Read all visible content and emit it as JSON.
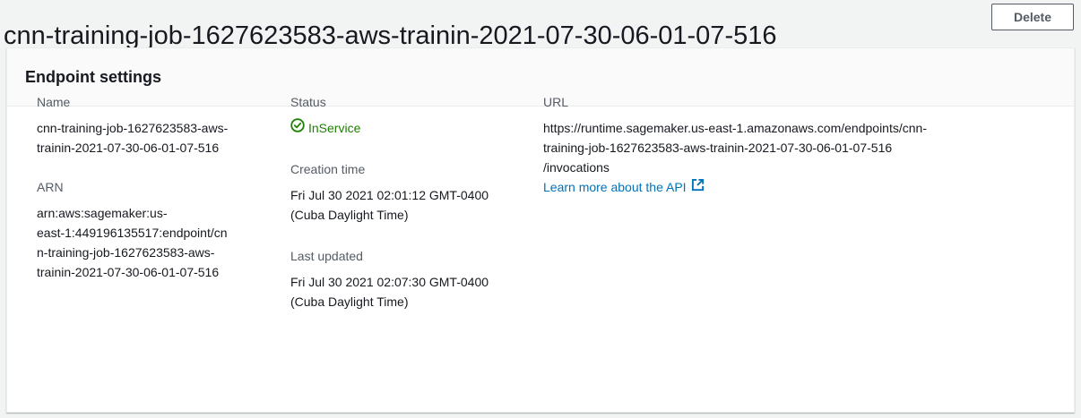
{
  "header": {
    "title": "cnn-training-job-1627623583-aws-trainin-2021-07-30-06-01-07-516",
    "delete_label": "Delete"
  },
  "card": {
    "title": "Endpoint settings"
  },
  "details": {
    "name_label": "Name",
    "name_line1": "cnn-training-job-1627623583-aws-",
    "name_line2": "trainin-2021-07-30-06-01-07-516",
    "arn_label": "ARN",
    "arn_line1": "arn:aws:sagemaker:us-",
    "arn_line2": "east-1:449196135517:endpoint/cn",
    "arn_line3": "n-training-job-1627623583-aws-",
    "arn_line4": "trainin-2021-07-30-06-01-07-516",
    "status_label": "Status",
    "status_value": "InService",
    "creation_label": "Creation time",
    "creation_line1": "Fri Jul 30 2021 02:01:12 GMT-0400",
    "creation_line2": "(Cuba Daylight Time)",
    "updated_label": "Last updated",
    "updated_line1": "Fri Jul 30 2021 02:07:30 GMT-0400",
    "updated_line2": "(Cuba Daylight Time)",
    "url_label": "URL",
    "url_line1": "https://runtime.sagemaker.us-east-1.amazonaws.com/endpoints/cnn-",
    "url_line2": "training-job-1627623583-aws-trainin-2021-07-30-06-01-07-516",
    "url_line3": "/invocations",
    "learn_more": "Learn more about the API"
  },
  "colors": {
    "status_success": "#1d8102",
    "link": "#0073bb"
  },
  "icons": {
    "status": "status-success-icon",
    "external": "external-link-icon"
  }
}
